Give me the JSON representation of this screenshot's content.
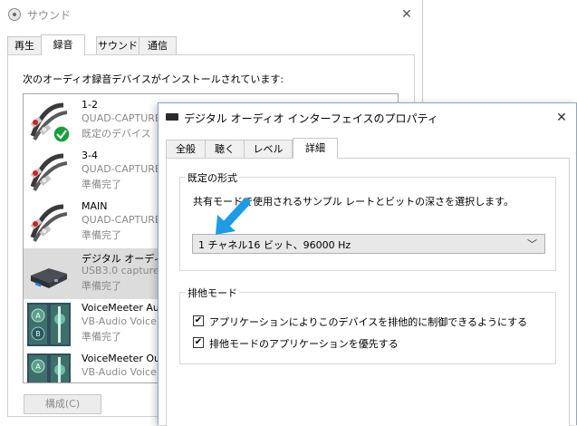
{
  "sound_window": {
    "title": "サウンド",
    "close_glyph": "✕",
    "tabs": [
      {
        "label": "再生",
        "active": false
      },
      {
        "label": "録音",
        "active": true
      },
      {
        "label": "サウンド",
        "active": false
      },
      {
        "label": "通信",
        "active": false
      }
    ],
    "instruction": "次のオーディオ録音デバイスがインストールされています:",
    "devices": [
      {
        "name": "1-2",
        "line2": "QUAD-CAPTURE",
        "line3": "既定のデバイス",
        "icon": "rca-cable-icon",
        "default_check": true
      },
      {
        "name": "3-4",
        "line2": "QUAD-CAPTURE",
        "line3": "準備完了",
        "icon": "rca-cable-icon"
      },
      {
        "name": "MAIN",
        "line2": "QUAD-CAPTURE",
        "line3": "準備完了",
        "icon": "rca-cable-icon"
      },
      {
        "name": "デジタル オーディオ",
        "line2": "USB3.0 capture",
        "line3": "準備完了",
        "icon": "capture-device-icon",
        "selected": true
      },
      {
        "name": "VoiceMeeter Au",
        "line2": "VB-Audio Voice",
        "line3": "準備完了",
        "icon": "voicemeeter-icon"
      },
      {
        "name": "VoiceMeeter Ou",
        "line2": "VB-Audio Voice",
        "line3": "",
        "icon": "voicemeeter-icon"
      }
    ],
    "configure_button": "構成(C)"
  },
  "properties_window": {
    "title": "デジタル オーディオ インターフェイスのプロパティ",
    "close_glyph": "✕",
    "tabs": [
      {
        "label": "全般",
        "active": false
      },
      {
        "label": "聴く",
        "active": false
      },
      {
        "label": "レベル",
        "active": false
      },
      {
        "label": "詳細",
        "active": true
      }
    ],
    "default_format": {
      "legend": "既定の形式",
      "description": "共有モードで使用されるサンプル レートとビットの深さを選択します。",
      "selected": "1 チャネル16 ビット、96000 Hz",
      "chevron": "﹀"
    },
    "exclusive_mode": {
      "legend": "排他モード",
      "options": [
        {
          "label": "アプリケーションによりこのデバイスを排他的に制御できるようにする",
          "checked": true
        },
        {
          "label": "排他モードのアプリケーションを優先する",
          "checked": true
        }
      ],
      "check_glyph": "✔"
    }
  },
  "colors": {
    "arrow_blue": "#1e9be6",
    "check_green": "#1a9e3c",
    "selection_gray": "#dcdcdc"
  }
}
